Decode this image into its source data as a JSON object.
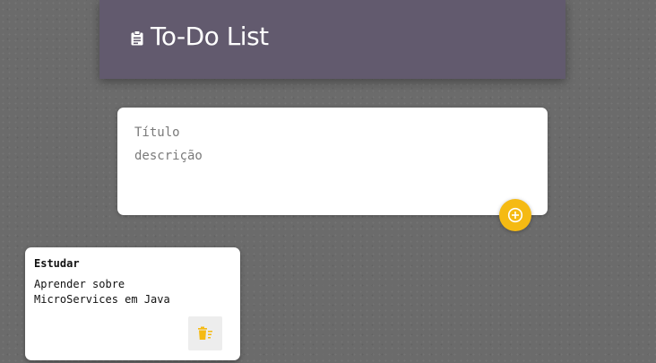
{
  "header": {
    "title": "To-Do List",
    "icon": "clipboard-icon"
  },
  "create_note": {
    "title_placeholder": "Título",
    "title_value": "",
    "content_placeholder": "descrição",
    "content_value": "",
    "add_icon": "add-circle-icon"
  },
  "notes": [
    {
      "title": "Estudar",
      "content": "Aprender sobre MicroServices em Java",
      "delete_icon": "delete-sweep-icon"
    }
  ],
  "colors": {
    "header_bg": "#625a6e",
    "accent": "#f5ba13",
    "background": "#6b6b6b"
  }
}
